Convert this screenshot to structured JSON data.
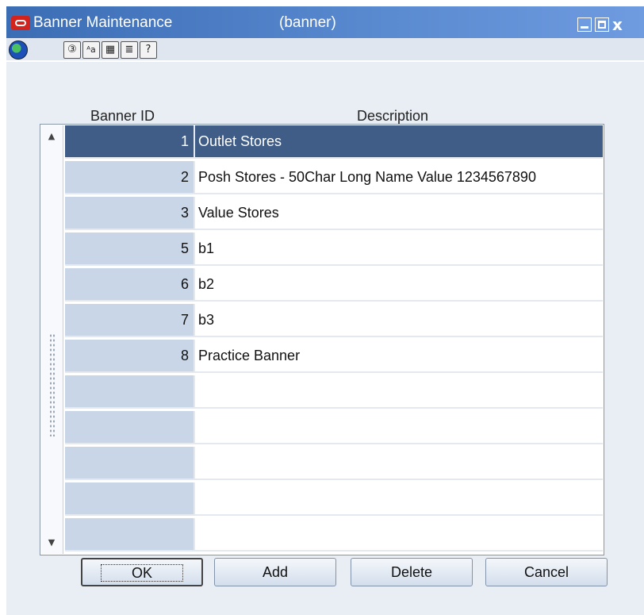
{
  "window": {
    "title": "Banner Maintenance",
    "context": "(banner)",
    "close_glyph": "x"
  },
  "toolbar": {
    "icons": [
      {
        "name": "globe-icon"
      },
      {
        "name": "refresh-icon",
        "glyph": "③"
      },
      {
        "name": "font-icon",
        "glyph": "ᴬa"
      },
      {
        "name": "calendar-icon",
        "glyph": "▦"
      },
      {
        "name": "notes-icon",
        "glyph": "≣"
      },
      {
        "name": "help-icon",
        "glyph": "?"
      }
    ]
  },
  "grid": {
    "columns": {
      "banner_id": "Banner ID",
      "description": "Description"
    },
    "rows": [
      {
        "id": "1",
        "desc": "Outlet Stores"
      },
      {
        "id": "2",
        "desc": "Posh Stores - 50Char Long Name Value 1234567890"
      },
      {
        "id": "3",
        "desc": "Value Stores"
      },
      {
        "id": "5",
        "desc": "b1"
      },
      {
        "id": "6",
        "desc": "b2"
      },
      {
        "id": "7",
        "desc": "b3"
      },
      {
        "id": "8",
        "desc": "Practice Banner"
      },
      {
        "id": "",
        "desc": ""
      },
      {
        "id": "",
        "desc": ""
      },
      {
        "id": "",
        "desc": ""
      },
      {
        "id": "",
        "desc": ""
      },
      {
        "id": "",
        "desc": ""
      }
    ],
    "selected_index": 0
  },
  "buttons": {
    "ok": "OK",
    "add": "Add",
    "delete": "Delete",
    "cancel": "Cancel"
  },
  "colors": {
    "selection": "#3f5d86",
    "id_column": "#c9d6e8",
    "titlebar": "#3b6db5"
  }
}
